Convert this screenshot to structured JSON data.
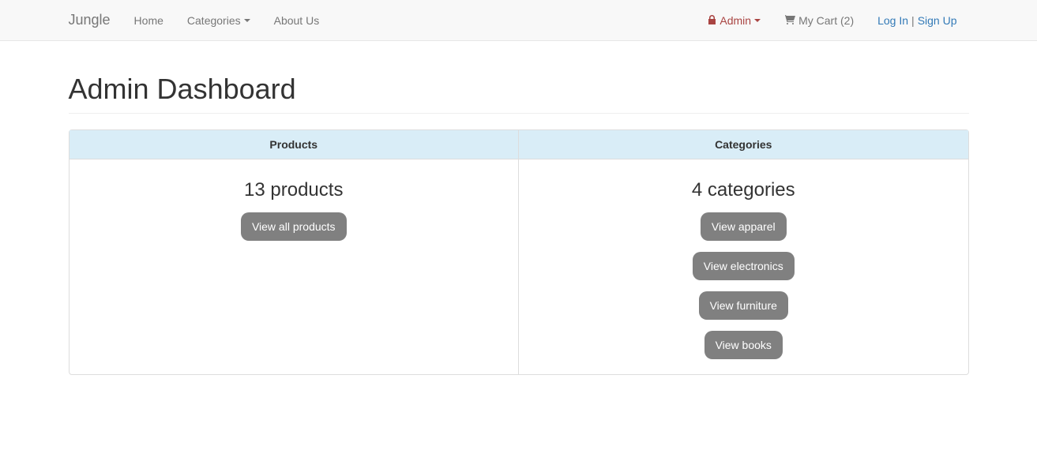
{
  "navbar": {
    "brand": "Jungle",
    "home": "Home",
    "categories": "Categories",
    "about": "About Us",
    "admin": "Admin",
    "cart_prefix": "My Cart (",
    "cart_count": "2",
    "cart_suffix": ")",
    "login": "Log In",
    "divider": "|",
    "signup": "Sign Up"
  },
  "page": {
    "title": "Admin Dashboard"
  },
  "dashboard": {
    "products_header": "Products",
    "categories_header": "Categories",
    "products_count_text": "13 products",
    "categories_count_text": "4 categories",
    "view_all_products": "View all products",
    "category_buttons": [
      "View apparel",
      "View electronics",
      "View furniture",
      "View books"
    ]
  }
}
